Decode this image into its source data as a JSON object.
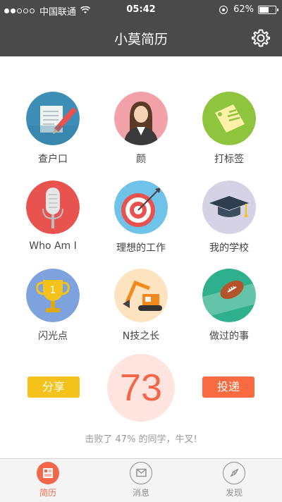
{
  "status_bar": {
    "carrier": "中国联通",
    "time": "05:42",
    "battery": "62%",
    "battery_level": 0.62
  },
  "header": {
    "title": "小莫简历",
    "settings_icon": "gear-icon"
  },
  "grid": [
    {
      "label": "查户口",
      "icon": "id-document-icon",
      "color": "#3d8fb8"
    },
    {
      "label": "颜",
      "icon": "person-portrait-icon",
      "color": "#f2a1a9"
    },
    {
      "label": "打标签",
      "icon": "tag-icon",
      "color": "#8fc43f"
    },
    {
      "label": "Who Am I",
      "icon": "microphone-icon",
      "color": "#e8534f"
    },
    {
      "label": "理想的工作",
      "icon": "target-icon",
      "color": "#6fc3e8"
    },
    {
      "label": "我的学校",
      "icon": "graduation-cap-icon",
      "color": "#d6d2e6"
    },
    {
      "label": "闪光点",
      "icon": "trophy-icon",
      "color": "#7ea2dd"
    },
    {
      "label": "N技之长",
      "icon": "excavator-icon",
      "color": "#fde3bf"
    },
    {
      "label": "做过的事",
      "icon": "football-icon",
      "color": "#2fb08c"
    }
  ],
  "score": {
    "share_label": "分享",
    "deliver_label": "投递",
    "value": "73",
    "beat_text": "击败了 47% 的同学，牛叉!"
  },
  "tabs": [
    {
      "label": "简历",
      "icon": "resume-icon",
      "active": true
    },
    {
      "label": "消息",
      "icon": "envelope-icon",
      "active": false
    },
    {
      "label": "发现",
      "icon": "compass-icon",
      "active": false
    }
  ],
  "colors": {
    "bar": "#4a4a4a",
    "accent": "#f26748",
    "share": "#f5c21b",
    "deliver": "#f86a3f",
    "tab_active": "#f26748",
    "tab_inactive": "#8e8e8e"
  }
}
